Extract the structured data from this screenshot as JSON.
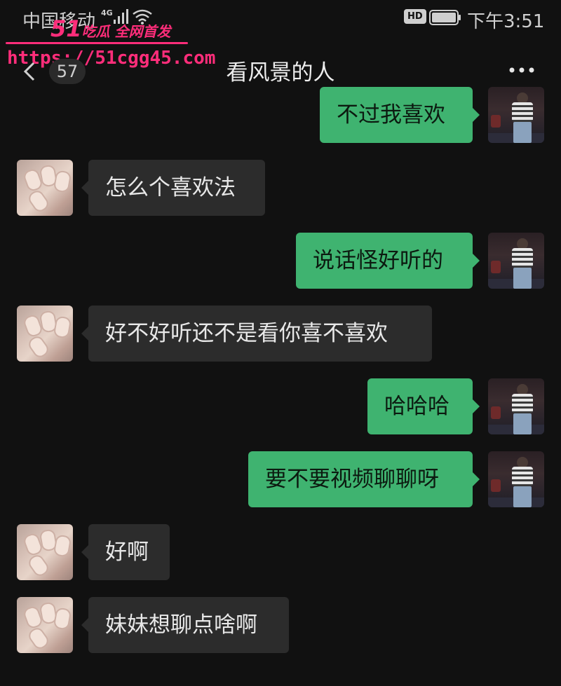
{
  "status_bar": {
    "carrier": "中国移动",
    "network": "4G",
    "hd_badge": "HD",
    "time": "下午3:51"
  },
  "watermark": {
    "brand_number": "51",
    "brand_text": "吃瓜 全网首发",
    "url": "https://51cgg45.com"
  },
  "nav": {
    "unread_count": "57",
    "title": "看风景的人"
  },
  "messages": [
    {
      "side": "right",
      "text": "不过我喜欢"
    },
    {
      "side": "left",
      "text": "怎么个喜欢法"
    },
    {
      "side": "right",
      "text": "说话怪好听的"
    },
    {
      "side": "left",
      "text": "好不好听还不是看你喜不喜欢"
    },
    {
      "side": "right",
      "text": "哈哈哈"
    },
    {
      "side": "right",
      "text": "要不要视频聊聊呀"
    },
    {
      "side": "left",
      "text": "好啊"
    },
    {
      "side": "left",
      "text": "妹妹想聊点啥啊"
    }
  ],
  "colors": {
    "background": "#111111",
    "incoming_bubble": "#2c2c2c",
    "outgoing_bubble": "#3fb370",
    "watermark": "#ff2d7a"
  }
}
